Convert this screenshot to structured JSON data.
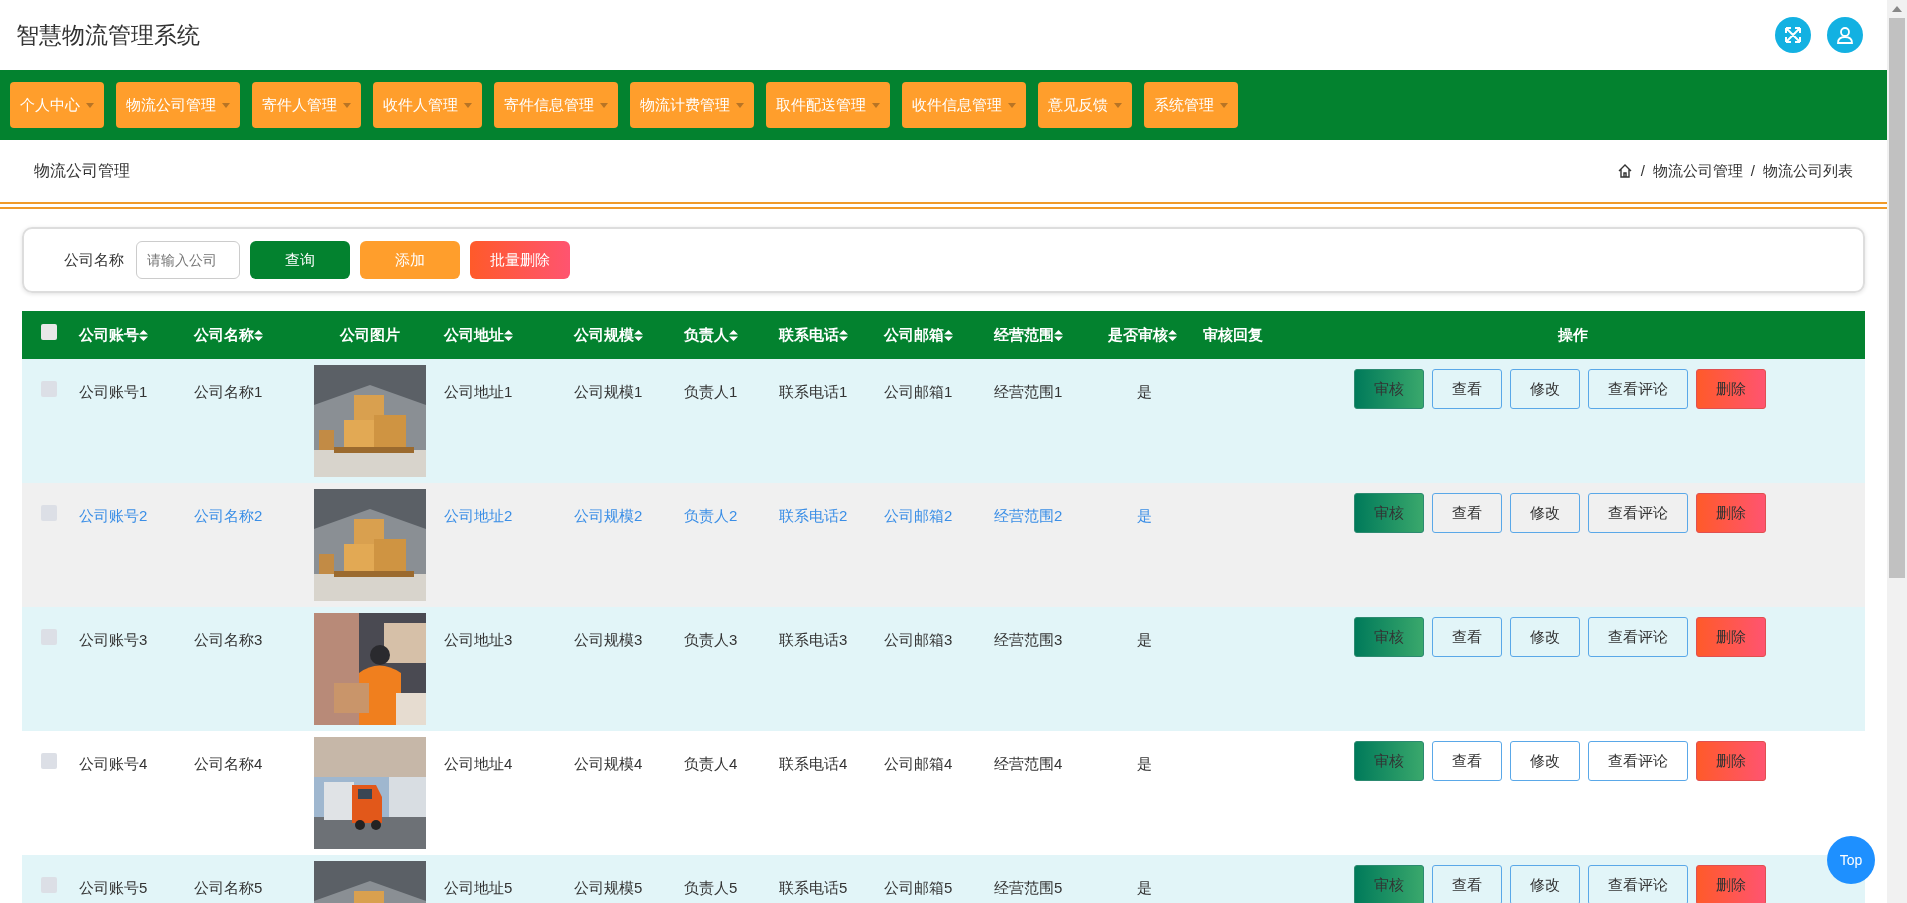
{
  "header": {
    "title": "智慧物流管理系统"
  },
  "nav": [
    {
      "label": "个人中心"
    },
    {
      "label": "物流公司管理"
    },
    {
      "label": "寄件人管理"
    },
    {
      "label": "收件人管理"
    },
    {
      "label": "寄件信息管理"
    },
    {
      "label": "物流计费管理"
    },
    {
      "label": "取件配送管理"
    },
    {
      "label": "收件信息管理"
    },
    {
      "label": "意见反馈"
    },
    {
      "label": "系统管理"
    }
  ],
  "page_title": "物流公司管理",
  "breadcrumb": [
    {
      "separator": "/",
      "label": "物流公司管理"
    },
    {
      "separator": "/",
      "label": "物流公司列表"
    }
  ],
  "filter": {
    "label": "公司名称",
    "placeholder": "请输入公司",
    "buttons": [
      {
        "label": "查询",
        "kind": "search"
      },
      {
        "label": "添加",
        "kind": "add"
      },
      {
        "label": "批量删除",
        "kind": "delete"
      }
    ]
  },
  "table": {
    "header_checked": false,
    "columns": [
      {
        "label": "公司账号",
        "kind": "text",
        "sortable": true
      },
      {
        "label": "公司名称",
        "kind": "text",
        "sortable": true
      },
      {
        "label": "公司图片",
        "kind": "picture",
        "sortable": false
      },
      {
        "label": "公司地址",
        "kind": "text",
        "sortable": true
      },
      {
        "label": "公司规模",
        "kind": "text",
        "sortable": true
      },
      {
        "label": "负责人",
        "kind": "text",
        "sortable": true
      },
      {
        "label": "联系电话",
        "kind": "text",
        "sortable": true
      },
      {
        "label": "公司邮箱",
        "kind": "text",
        "sortable": true
      },
      {
        "label": "经营范围",
        "kind": "text",
        "sortable": true
      },
      {
        "label": "是否审核",
        "kind": "center",
        "sortable": true
      },
      {
        "label": "审核回复",
        "kind": "blank",
        "sortable": false
      },
      {
        "label": "操作",
        "kind": "actions",
        "sortable": false
      }
    ],
    "rows": [
      {
        "checked": false,
        "hovered": false,
        "cells": [
          "公司账号1",
          "公司名称1",
          {
            "kind": "picture"
          },
          "公司地址1",
          "公司规模1",
          "负责人1",
          "联系电话1",
          "公司邮箱1",
          "经营范围1",
          "是"
        ],
        "actions": [
          {
            "label": "审核",
            "kind": "review"
          },
          {
            "label": "查看",
            "kind": "outline"
          },
          {
            "label": "修改",
            "kind": "outline"
          },
          {
            "label": "查看评论",
            "kind": "outline"
          },
          {
            "label": "删除",
            "kind": "delete"
          }
        ]
      },
      {
        "checked": false,
        "hovered": true,
        "cells": [
          "公司账号2",
          "公司名称2",
          {
            "kind": "picture"
          },
          "公司地址2",
          "公司规模2",
          "负责人2",
          "联系电话2",
          "公司邮箱2",
          "经营范围2",
          "是"
        ],
        "actions": [
          {
            "label": "审核",
            "kind": "review"
          },
          {
            "label": "查看",
            "kind": "outline"
          },
          {
            "label": "修改",
            "kind": "outline"
          },
          {
            "label": "查看评论",
            "kind": "outline"
          },
          {
            "label": "删除",
            "kind": "delete"
          }
        ]
      },
      {
        "checked": false,
        "hovered": false,
        "cells": [
          "公司账号3",
          "公司名称3",
          {
            "kind": "picture"
          },
          "公司地址3",
          "公司规模3",
          "负责人3",
          "联系电话3",
          "公司邮箱3",
          "经营范围3",
          "是"
        ],
        "actions": [
          {
            "label": "审核",
            "kind": "review"
          },
          {
            "label": "查看",
            "kind": "outline"
          },
          {
            "label": "修改",
            "kind": "outline"
          },
          {
            "label": "查看评论",
            "kind": "outline"
          },
          {
            "label": "删除",
            "kind": "delete"
          }
        ]
      },
      {
        "checked": false,
        "hovered": false,
        "cells": [
          "公司账号4",
          "公司名称4",
          {
            "kind": "picture"
          },
          "公司地址4",
          "公司规模4",
          "负责人4",
          "联系电话4",
          "公司邮箱4",
          "经营范围4",
          "是"
        ],
        "actions": [
          {
            "label": "审核",
            "kind": "review"
          },
          {
            "label": "查看",
            "kind": "outline"
          },
          {
            "label": "修改",
            "kind": "outline"
          },
          {
            "label": "查看评论",
            "kind": "outline"
          },
          {
            "label": "删除",
            "kind": "delete"
          }
        ]
      },
      {
        "checked": false,
        "hovered": false,
        "cells": [
          "公司账号5",
          "公司名称5",
          {
            "kind": "picture"
          },
          "公司地址5",
          "公司规模5",
          "负责人5",
          "联系电话5",
          "公司邮箱5",
          "经营范围5",
          "是"
        ],
        "actions": [
          {
            "label": "审核",
            "kind": "review"
          },
          {
            "label": "查看",
            "kind": "outline"
          },
          {
            "label": "修改",
            "kind": "outline"
          },
          {
            "label": "查看评论",
            "kind": "outline"
          },
          {
            "label": "删除",
            "kind": "delete"
          }
        ]
      }
    ]
  },
  "top_button": "Top"
}
